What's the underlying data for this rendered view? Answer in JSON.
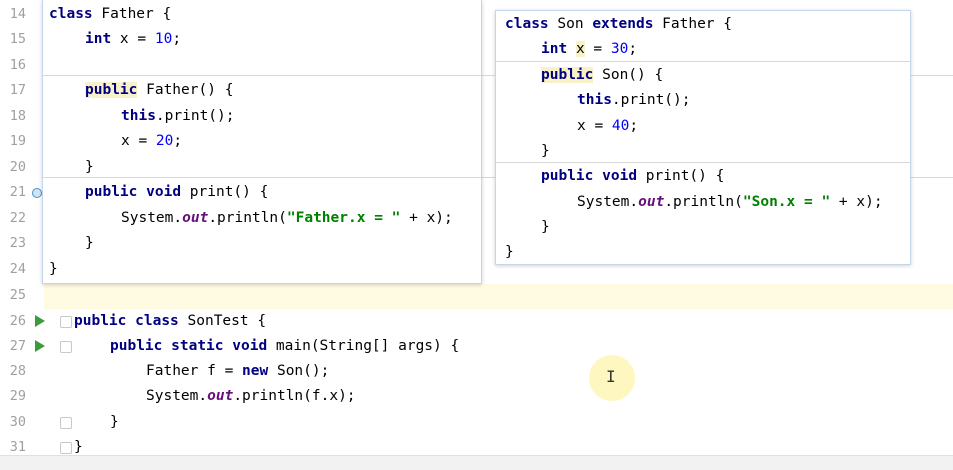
{
  "line_numbers": [
    "14",
    "15",
    "16",
    "17",
    "18",
    "19",
    "20",
    "21",
    "22",
    "23",
    "24",
    "25",
    "26",
    "27",
    "28",
    "29",
    "30",
    "31"
  ],
  "father_popup": {
    "l_class_kw": "class",
    "l_class_name": " Father {",
    "l_int_kw": "int",
    "l_int_name": " x = ",
    "l_int_val": "10",
    "l_int_end": ";",
    "l_ctor_kw": "public",
    "l_ctor_rest": " Father() {",
    "l_this_kw": "this",
    "l_this_rest": ".print();",
    "l_assign": "x = ",
    "l_assign_val": "20",
    "l_assign_end": ";",
    "l_close_brace": "}",
    "l_print_kw1": "public",
    "l_print_kw2": "void",
    "l_print_rest": " print() {",
    "l_sys": "System.",
    "l_out": "out",
    "l_println": ".println(",
    "l_str": "\"Father.x = \"",
    "l_plus": " + x);",
    "l_close2": "}",
    "l_close3": "}"
  },
  "son_popup": {
    "l_class_kw": "class",
    "l_class_name": " Son ",
    "l_extends_kw": "extends",
    "l_extends_rest": " Father {",
    "l_int_kw": "int",
    "l_int_x": "x",
    "l_int_eq": " = ",
    "l_int_val": "30",
    "l_int_end": ";",
    "l_ctor_kw": "public",
    "l_ctor_rest": " Son() {",
    "l_this_kw": "this",
    "l_this_rest": ".print();",
    "l_assign": "x = ",
    "l_assign_val": "40",
    "l_assign_end": ";",
    "l_close_brace": "}",
    "l_print_kw1": "public",
    "l_print_kw2": "void",
    "l_print_rest": " print() {",
    "l_sys": "System.",
    "l_out": "out",
    "l_println": ".println(",
    "l_str": "\"Son.x = \"",
    "l_plus": " + x);",
    "l_close2": "}",
    "l_close3": "}"
  },
  "editor": {
    "l26_kw1": "public",
    "l26_kw2": "class",
    "l26_rest": " SonTest {",
    "l27_kw1": "public",
    "l27_kw2": "static",
    "l27_kw3": "void",
    "l27_rest": " main(String[] args) {",
    "l28_a": "Father f = ",
    "l28_kw": "new",
    "l28_b": " Son();",
    "l29_sys": "System.",
    "l29_out": "out",
    "l29_rest": ".println(f.x);",
    "l30": "}",
    "l31": "}"
  },
  "colors": {
    "keyword": "#000080",
    "number": "#0000ff",
    "string": "#008000",
    "static_field": "#660e7a",
    "run_icon": "#3c9c3c",
    "current_line": "#fffbe3"
  },
  "icons": [
    "run-icon",
    "fold-icon",
    "override-marker-icon",
    "text-cursor-icon"
  ]
}
